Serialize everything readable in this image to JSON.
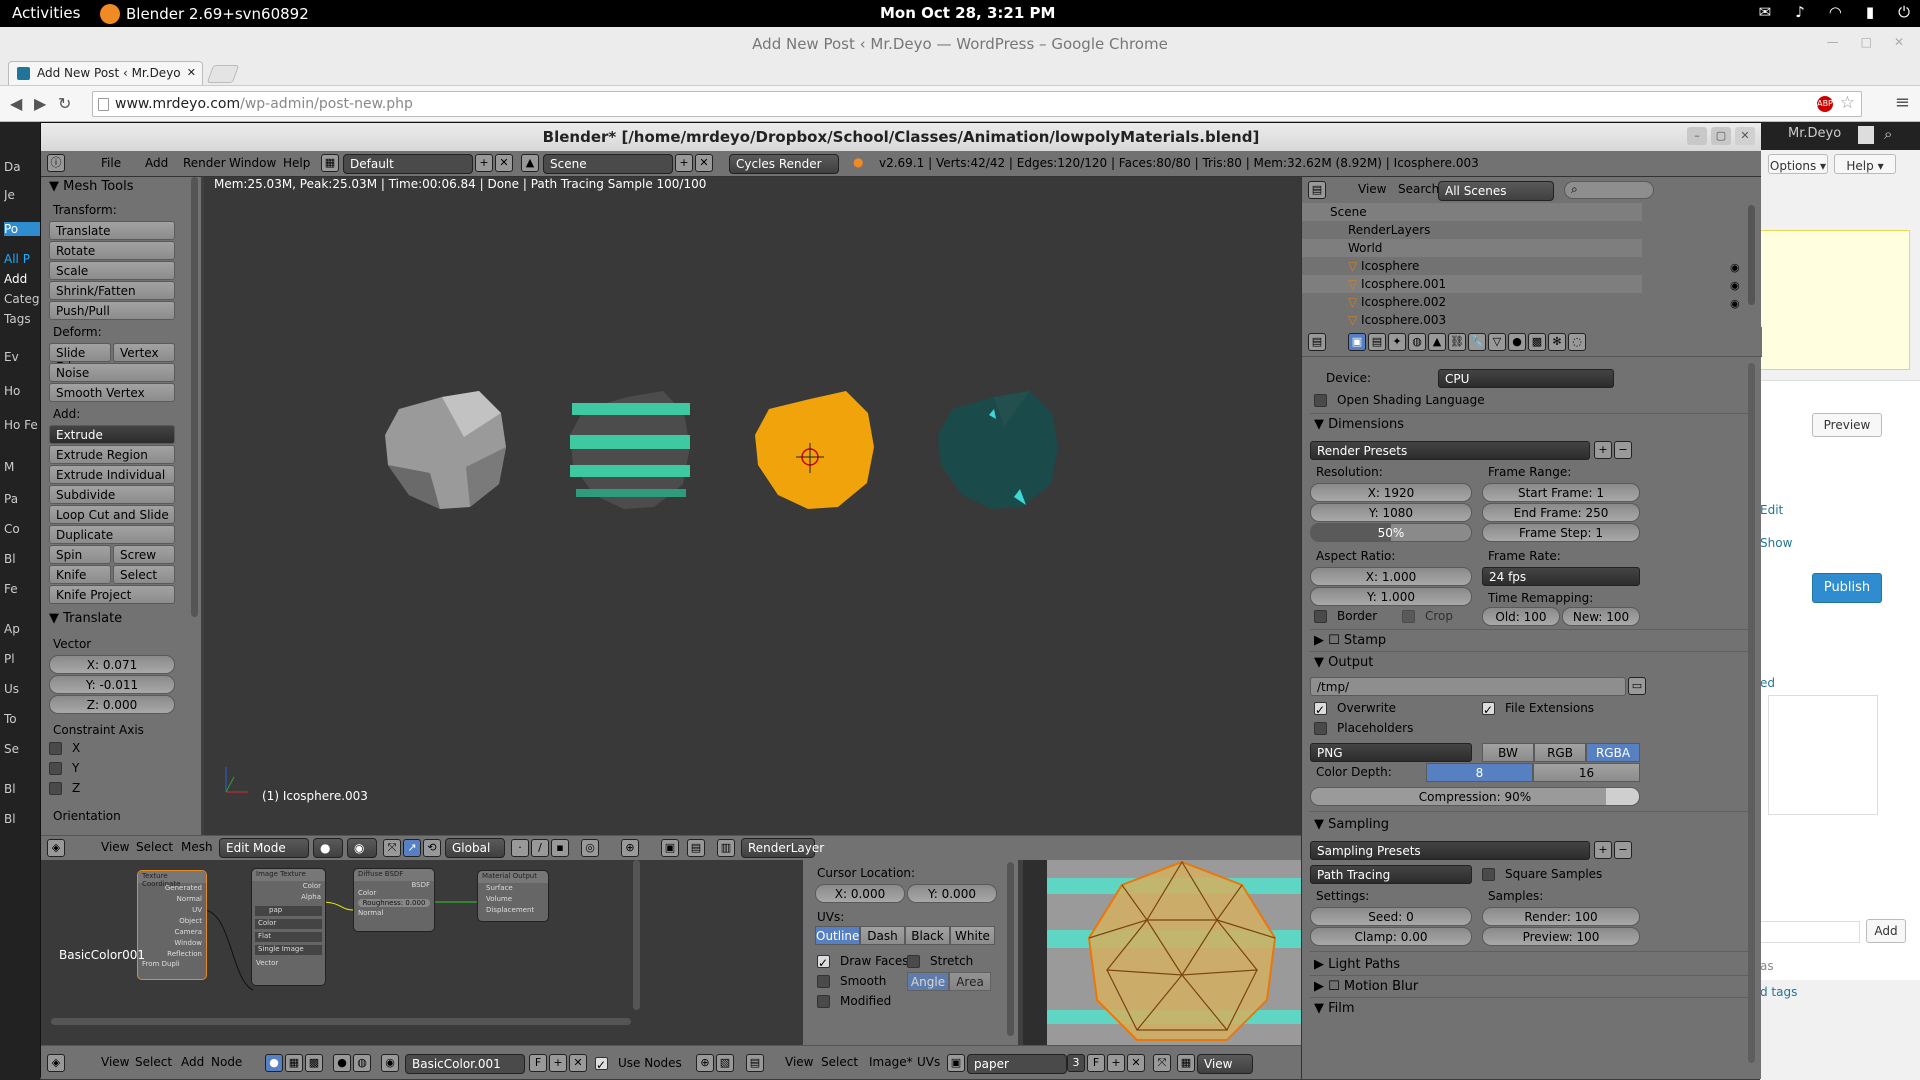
{
  "gnome": {
    "activities": "Activities",
    "app_name": "Blender 2.69+svn60892",
    "clock": "Mon Oct 28,  3:21 PM"
  },
  "chrome": {
    "window_title": "Add New Post ‹ Mr.Deyo — WordPress – Google Chrome",
    "tab_title": "Add New Post ‹ Mr.Deyo",
    "url_host": "www.mrdeyo.com",
    "url_path": "/wp-admin/post-new.php",
    "abp": "ABP"
  },
  "wordpress": {
    "user": "Mr.Deyo",
    "screen_options": "Options ▾",
    "help": "Help ▾",
    "preview": "Preview",
    "publish": "Publish",
    "add": "Add",
    "edit": "Edit",
    "show": "Show",
    "ed": "ed",
    "tags": "d tags",
    "has": "as",
    "sidebar": [
      "Da",
      "Je",
      "Po",
      "All P",
      "Add",
      "Categ",
      "Tags",
      "Ev",
      "Ho",
      "Ho Fe",
      "M",
      "Pa",
      "Co",
      "Bl",
      "Fe",
      "Ap",
      "Pl",
      "Us",
      "To",
      "Se",
      "Bl",
      "Bl"
    ]
  },
  "blender": {
    "title": "Blender* [/home/mrdeyo/Dropbox/School/Classes/Animation/lowpolyMaterials.blend]",
    "menu": [
      "File",
      "Add",
      "Render",
      "Window",
      "Help"
    ],
    "layout": "Default",
    "scene": "Scene",
    "engine": "Cycles Render",
    "stats": "v2.69.1 | Verts:42/42 | Edges:120/120 | Faces:80/80 | Tris:80 | Mem:32.62M (8.92M) | Icosphere.003",
    "viewport_status": "Mem:25.03M, Peak:25.03M | Time:00:06.84 | Done | Path Tracing Sample 100/100",
    "object_label": "(1) Icosphere.003",
    "tools": {
      "title": "Mesh Tools",
      "transform_label": "Transform:",
      "transform": [
        "Translate",
        "Rotate",
        "Scale",
        "Shrink/Fatten",
        "Push/Pull"
      ],
      "deform_label": "Deform:",
      "slide_edge": "Slide Edge",
      "vertex": "Vertex",
      "noise": "Noise",
      "smooth_vertex": "Smooth Vertex",
      "add_label": "Add:",
      "extrude": "Extrude",
      "add_items": [
        "Extrude Region",
        "Extrude Individual",
        "Subdivide",
        "Loop Cut and Slide",
        "Duplicate"
      ],
      "spin": "Spin",
      "screw": "Screw",
      "knife": "Knife",
      "select": "Select",
      "knife_project": "Knife Project",
      "op_title": "Translate",
      "vector_label": "Vector",
      "vx": "X: 0.071",
      "vy": "Y: -0.011",
      "vz": "Z: 0.000",
      "constraint_label": "Constraint Axis",
      "cx": "X",
      "cy": "Y",
      "cz": "Z",
      "orientation": "Orientation"
    },
    "view3d_header": {
      "view": "View",
      "select": "Select",
      "mesh": "Mesh",
      "mode": "Edit Mode",
      "orient": "Global",
      "layer": "RenderLayer"
    },
    "nodes": {
      "texcoord": "Texture Coordinate",
      "texcoord_outs": [
        "Generated",
        "Normal",
        "UV",
        "Object",
        "Camera",
        "Window",
        "Reflection"
      ],
      "from_dupli": "From Dupli",
      "image": "Image Texture",
      "image_outs": [
        "Color",
        "Alpha"
      ],
      "image_name": "pap",
      "color": "Color",
      "flat": "Flat",
      "single": "Single Image",
      "vector": "Vector",
      "diffuse": "Diffuse BSDF",
      "bsdf": "BSDF",
      "roughness": "Roughness: 0.000",
      "normal": "Normal",
      "output": "Material Output",
      "out_ins": [
        "Surface",
        "Volume",
        "Displacement"
      ],
      "material": "BasicColor001"
    },
    "uv": {
      "cursor_label": "Cursor Location:",
      "cx": "X: 0.000",
      "cy": "Y: 0.000",
      "uvs_label": "UVs:",
      "outline": "Outline",
      "dash": "Dash",
      "black": "Black",
      "white": "White",
      "draw_faces": "Draw Faces",
      "stretch": "Stretch",
      "smooth": "Smooth",
      "angle": "Angle",
      "area": "Area",
      "modified": "Modified"
    },
    "node_header": {
      "view": "View",
      "select": "Select",
      "add": "Add",
      "node": "Node",
      "material": "BasicColor.001",
      "f": "F",
      "use_nodes": "Use Nodes"
    },
    "image_header": {
      "view": "View",
      "image": "Image*",
      "uvs": "UVs",
      "image_name": "paper",
      "users": "3",
      "f": "F",
      "view2": "View"
    },
    "outliner": {
      "view": "View",
      "search": "Search",
      "scenes": "All Scenes",
      "items": [
        "Scene",
        "RenderLayers",
        "World",
        "Icosphere",
        "Icosphere.001",
        "Icosphere.002",
        "Icosphere.003"
      ]
    },
    "props": {
      "device_label": "Device:",
      "device": "CPU",
      "osl": "Open Shading Language",
      "dimensions": "Dimensions",
      "render_presets": "Render Presets",
      "resolution_label": "Resolution:",
      "res_x": "X: 1920",
      "res_y": "Y: 1080",
      "res_pct": "50%",
      "frame_range_label": "Frame Range:",
      "start": "Start Frame: 1",
      "end": "End Frame: 250",
      "step": "Frame Step: 1",
      "aspect_label": "Aspect Ratio:",
      "ax": "X: 1.000",
      "ay": "Y: 1.000",
      "frame_rate_label": "Frame Rate:",
      "fps": "24 fps",
      "remap_label": "Time Remapping:",
      "old": "Old: 100",
      "new": "New: 100",
      "border": "Border",
      "crop": "Crop",
      "stamp": "Stamp",
      "output": "Output",
      "path": "/tmp/",
      "overwrite": "Overwrite",
      "file_ext": "File Extensions",
      "placeholders": "Placeholders",
      "format": "PNG",
      "bw": "BW",
      "rgb": "RGB",
      "rgba": "RGBA",
      "depth_label": "Color Depth:",
      "d8": "8",
      "d16": "16",
      "compression": "Compression: 90%",
      "sampling": "Sampling",
      "sampling_presets": "Sampling Presets",
      "integrator": "Path Tracing",
      "square": "Square Samples",
      "settings_label": "Settings:",
      "samples_label": "Samples:",
      "seed": "Seed: 0",
      "clamp": "Clamp: 0.00",
      "render": "Render: 100",
      "preview": "Preview: 100",
      "light_paths": "Light Paths",
      "motion_blur": "Motion Blur",
      "film": "Film"
    }
  },
  "colors": {
    "orange": "#f0a30a",
    "teal_dark": "#1b4a4a",
    "teal_stripe": "#3fc9a0",
    "grey_sphere": "#8c8c8c"
  }
}
